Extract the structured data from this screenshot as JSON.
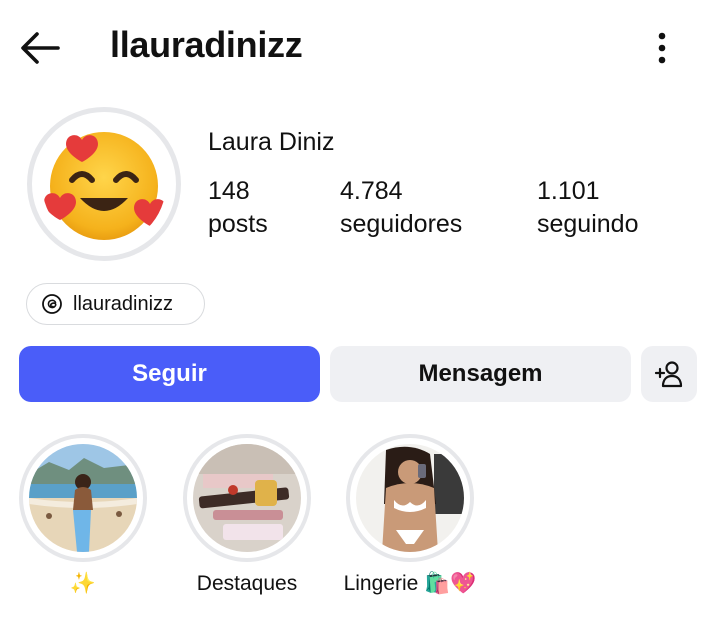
{
  "header": {
    "username": "llauradinizz",
    "back_icon": "arrow-left-icon",
    "more_icon": "more-vertical-icon"
  },
  "profile": {
    "avatar_icon": "smiling-face-with-hearts-emoji",
    "display_name": "Laura Diniz",
    "stats": [
      {
        "value": "148",
        "label": "posts"
      },
      {
        "value": "4.784",
        "label": "seguidores"
      },
      {
        "value": "1.101",
        "label": "seguindo"
      }
    ],
    "threads": {
      "icon": "threads-icon",
      "label": "llauradinizz"
    }
  },
  "actions": {
    "follow_label": "Seguir",
    "message_label": "Mensagem",
    "add_user_icon": "add-user-icon",
    "follow_color": "#4a5df9"
  },
  "highlights": [
    {
      "label": "✨"
    },
    {
      "label": "Destaques"
    },
    {
      "label": "Lingerie 🛍️💖"
    }
  ]
}
